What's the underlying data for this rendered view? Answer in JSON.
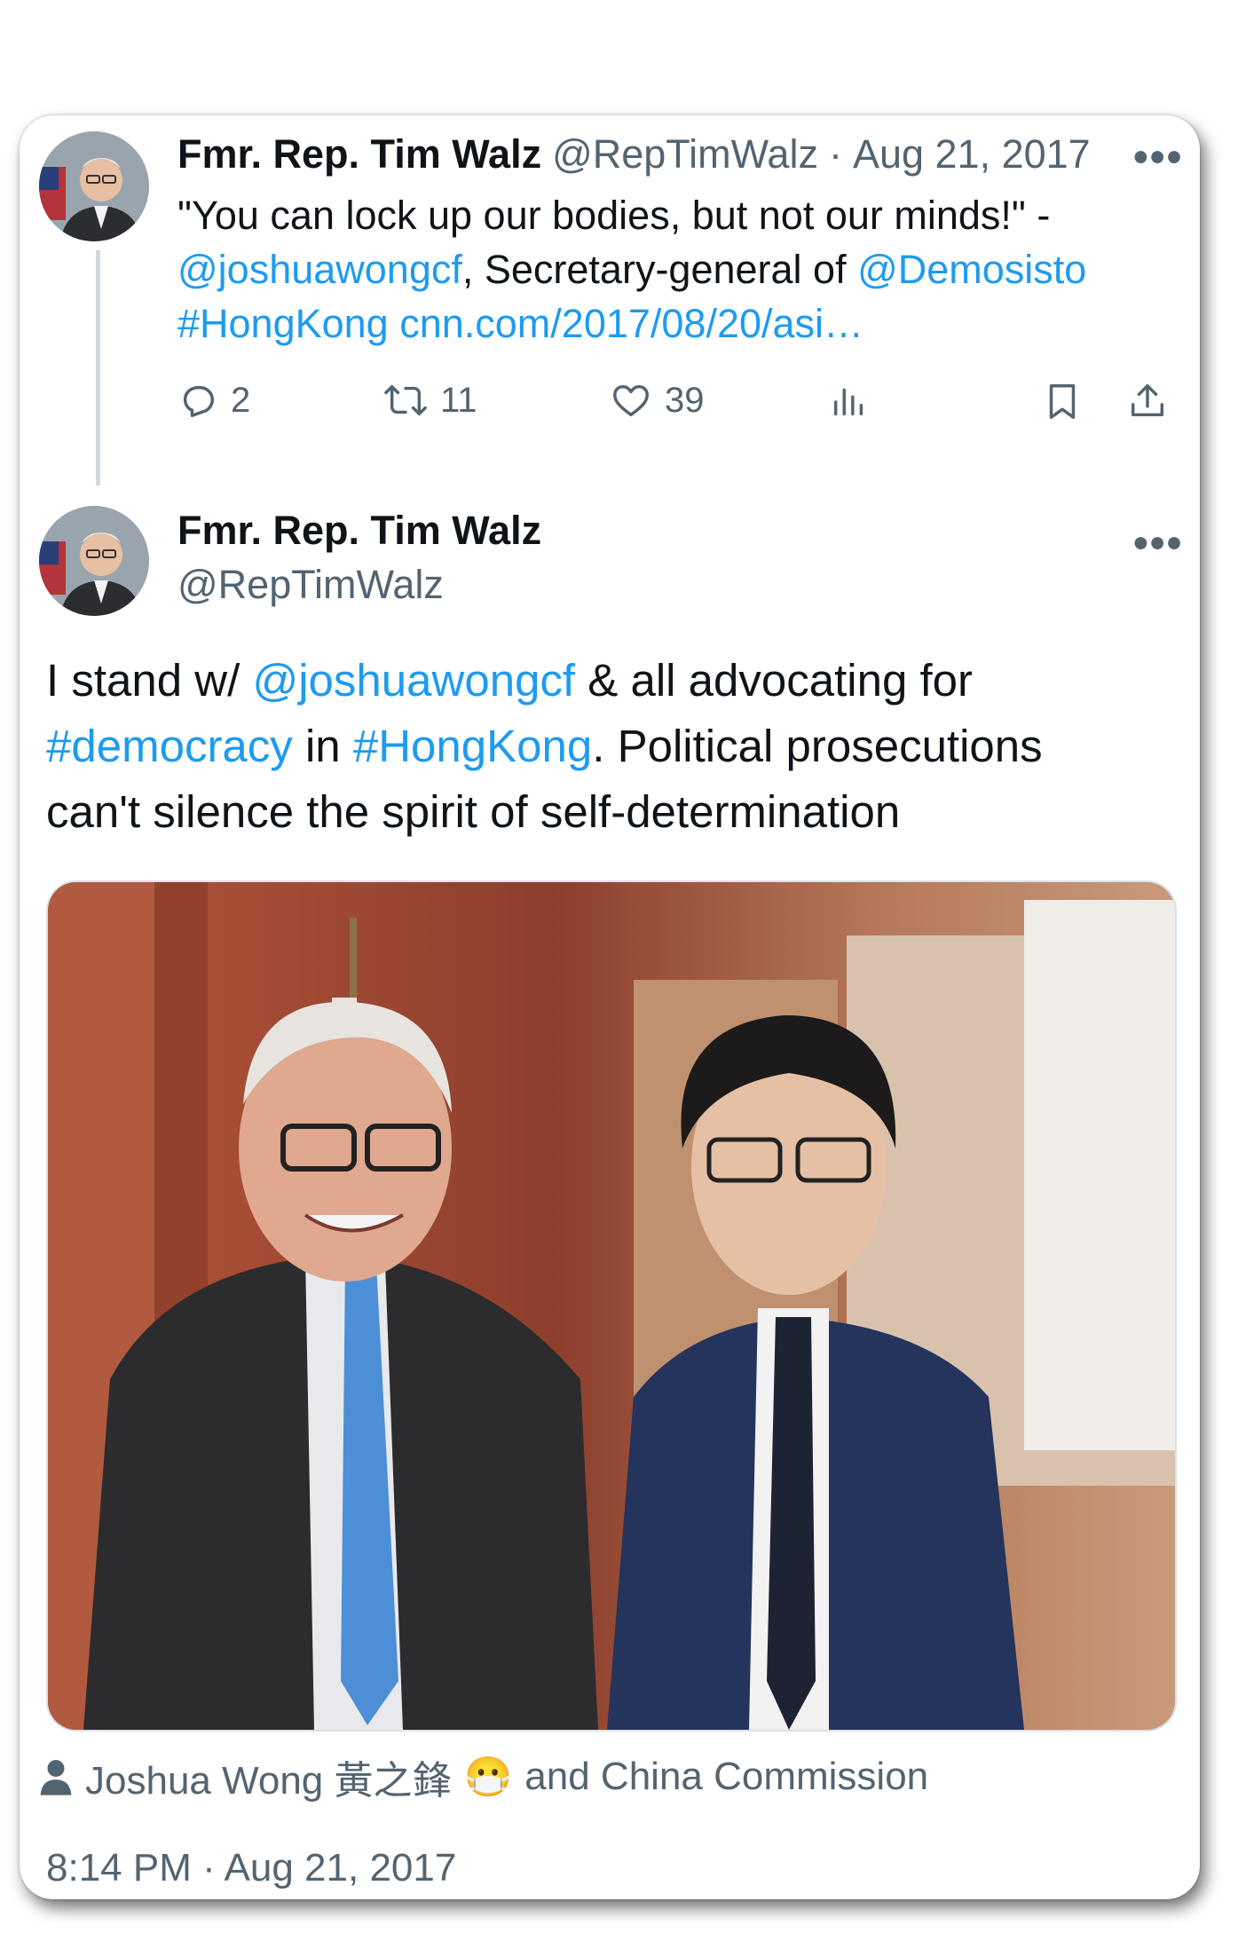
{
  "reply_tweet": {
    "author_name": "Fmr. Rep. Tim Walz",
    "author_handle": "@RepTimWalz",
    "separator": "·",
    "date": "Aug 21, 2017",
    "more_label": "•••",
    "text_line1": "\"You can lock up our bodies, but not our minds!\" -",
    "mention1": "@joshuawongcf",
    "text_line2_mid": ", Secretary-general of ",
    "mention2": "@Demosisto",
    "hashtag": "#HongKong",
    "url": "cnn.com/2017/08/20/asi…",
    "counts": {
      "replies": "2",
      "reposts": "11",
      "likes": "39"
    },
    "icons": [
      "reply-icon",
      "repost-icon",
      "like-icon",
      "views-icon",
      "bookmark-icon",
      "share-icon"
    ]
  },
  "main_tweet": {
    "author_name": "Fmr. Rep. Tim Walz",
    "author_handle": "@RepTimWalz",
    "more_label": "•••",
    "text_part1": "I stand w/ ",
    "mention": "@joshuawongcf",
    "text_part2": " & all advocating for",
    "hashtag1": "#democracy",
    "text_part3": " in ",
    "hashtag2": "#HongKong",
    "text_part4": ". Political prosecutions",
    "text_line3": "can't silence the spirit of self-determination",
    "tagged_user": "Joshua Wong 黃之鋒",
    "tagged_emoji": "😷",
    "tagged_rest": "and China Commission",
    "timestamp": "8:14 PM · Aug 21, 2017"
  },
  "colors": {
    "link": "#1d9bf0",
    "muted": "#536471",
    "text": "#0f1419",
    "thread_line": "#cfd9de"
  }
}
